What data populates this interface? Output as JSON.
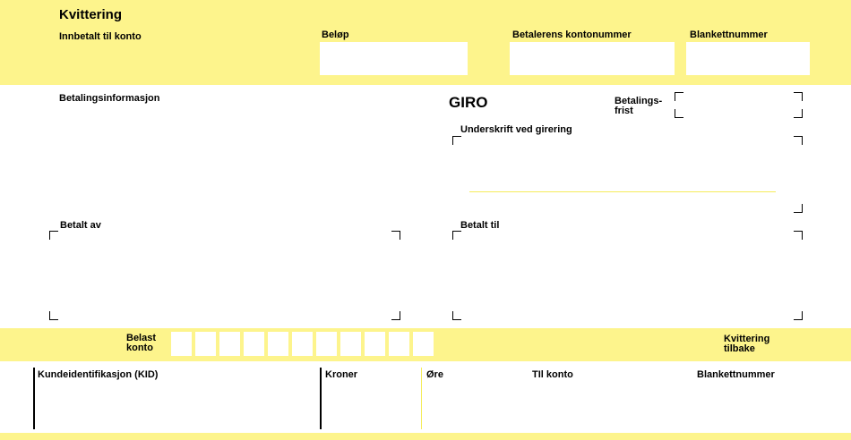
{
  "colors": {
    "yellow": "#fdf48c",
    "line_yellow": "#f5ec5a",
    "black": "#000000",
    "white": "#ffffff"
  },
  "receipt": {
    "title": "Kvittering",
    "paid_to_account": "Innbetalt til konto",
    "amount": "Beløp",
    "payer_account": "Betalerens kontonummer",
    "form_number": "Blankettnummer"
  },
  "payment_info": "Betalingsinformasjon",
  "giro": "GIRO",
  "due_date": {
    "line1": "Betalings-",
    "line2": "frist"
  },
  "signature": "Underskrift ved girering",
  "paid_by": "Betalt av",
  "paid_to": "Betalt til",
  "debit_account": {
    "line1": "Belast",
    "line2": "konto"
  },
  "receipt_back": {
    "line1": "Kvittering",
    "line2": "tilbake"
  },
  "footer": {
    "kid": "Kundeidentifikasjon (KID)",
    "kroner": "Kroner",
    "ore": "Øre",
    "to_account": "TIl konto",
    "form_number": "Blankettnummer"
  }
}
